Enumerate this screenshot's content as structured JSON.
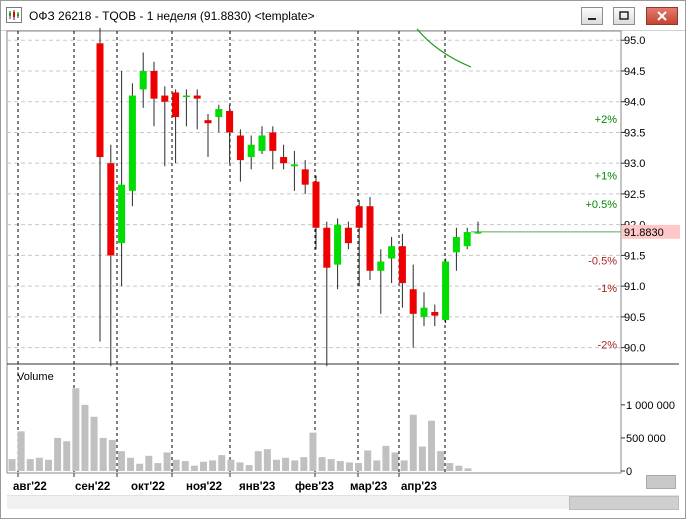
{
  "window": {
    "title": "ОФЗ 26218 - TQOB - 1 неделя (91.8830) <template>",
    "icons": [
      "chart-window-icon",
      "minimize-icon",
      "maximize-icon",
      "close-icon"
    ]
  },
  "colors": {
    "up": "#00dd00",
    "down": "#ee0000",
    "wick": "#2a2a2a",
    "volume_bar": "#c0c0c0",
    "grid": "#c8c8c8",
    "period_separator": "#000000",
    "pct_positive": "#008800",
    "pct_negative": "#aa2222",
    "price_marker_bg": "#ffc8c8",
    "price_line": "#5aaa5a"
  },
  "chart_data": {
    "type": "candlestick",
    "price_axis": {
      "ticks": [
        "95.0",
        "94.5",
        "94.0",
        "93.5",
        "93.0",
        "92.5",
        "92.0",
        "91.5",
        "91.0",
        "90.5",
        "90.0"
      ],
      "ylim": [
        89.75,
        95.15
      ]
    },
    "time_axis": {
      "labels": [
        "авг'22",
        "сен'22",
        "окт'22",
        "ноя'22",
        "янв'23",
        "фев'23",
        "мар'23",
        "апр'23"
      ]
    },
    "last_price": "91.8830",
    "pct_levels": [
      {
        "label": "+2%",
        "value": 93.72
      },
      {
        "label": "+1%",
        "value": 92.8
      },
      {
        "label": "+0.5%",
        "value": 92.34
      },
      {
        "label": "-0.5%",
        "value": 91.42
      },
      {
        "label": "-1%",
        "value": 90.97
      },
      {
        "label": "-2%",
        "value": 90.05
      }
    ],
    "candles": [
      {
        "o": 94.95,
        "h": 95.2,
        "l": 90.1,
        "c": 93.1
      },
      {
        "o": 93.0,
        "h": 93.3,
        "l": 89.7,
        "c": 91.5
      },
      {
        "o": 91.7,
        "h": 94.5,
        "l": 91.0,
        "c": 92.65
      },
      {
        "o": 92.55,
        "h": 94.3,
        "l": 92.3,
        "c": 94.1
      },
      {
        "o": 94.2,
        "h": 94.8,
        "l": 93.9,
        "c": 94.5
      },
      {
        "o": 94.5,
        "h": 94.65,
        "l": 93.6,
        "c": 94.05
      },
      {
        "o": 94.1,
        "h": 94.25,
        "l": 92.95,
        "c": 94.0
      },
      {
        "o": 94.15,
        "h": 94.2,
        "l": 93.0,
        "c": 93.75
      },
      {
        "o": 94.1,
        "h": 94.2,
        "l": 93.6,
        "c": 94.1
      },
      {
        "o": 94.1,
        "h": 94.2,
        "l": 93.55,
        "c": 94.05
      },
      {
        "o": 93.7,
        "h": 93.8,
        "l": 93.1,
        "c": 93.65
      },
      {
        "o": 93.75,
        "h": 93.95,
        "l": 93.5,
        "c": 93.88
      },
      {
        "o": 93.85,
        "h": 93.95,
        "l": 93.0,
        "c": 93.5
      },
      {
        "o": 93.45,
        "h": 93.55,
        "l": 92.7,
        "c": 93.05
      },
      {
        "o": 93.1,
        "h": 93.45,
        "l": 92.9,
        "c": 93.3
      },
      {
        "o": 93.2,
        "h": 93.6,
        "l": 93.15,
        "c": 93.45
      },
      {
        "o": 93.5,
        "h": 93.6,
        "l": 92.9,
        "c": 93.2
      },
      {
        "o": 93.1,
        "h": 93.3,
        "l": 92.9,
        "c": 93.0
      },
      {
        "o": 92.95,
        "h": 93.2,
        "l": 92.55,
        "c": 92.98
      },
      {
        "o": 92.9,
        "h": 93.05,
        "l": 92.5,
        "c": 92.65
      },
      {
        "o": 92.7,
        "h": 92.8,
        "l": 91.6,
        "c": 91.95
      },
      {
        "o": 91.95,
        "h": 92.05,
        "l": 89.7,
        "c": 91.3
      },
      {
        "o": 91.35,
        "h": 92.1,
        "l": 90.95,
        "c": 92.0
      },
      {
        "o": 91.95,
        "h": 92.05,
        "l": 91.6,
        "c": 91.7
      },
      {
        "o": 92.3,
        "h": 92.4,
        "l": 91.0,
        "c": 91.95
      },
      {
        "o": 92.3,
        "h": 92.45,
        "l": 91.1,
        "c": 91.25
      },
      {
        "o": 91.25,
        "h": 91.6,
        "l": 90.55,
        "c": 91.4
      },
      {
        "o": 91.45,
        "h": 91.8,
        "l": 91.05,
        "c": 91.65
      },
      {
        "o": 91.65,
        "h": 91.85,
        "l": 90.65,
        "c": 91.05
      },
      {
        "o": 90.95,
        "h": 91.35,
        "l": 90.0,
        "c": 90.55
      },
      {
        "o": 90.5,
        "h": 90.9,
        "l": 90.35,
        "c": 90.65
      },
      {
        "o": 90.58,
        "h": 90.7,
        "l": 90.35,
        "c": 90.52
      },
      {
        "o": 90.45,
        "h": 91.45,
        "l": 90.4,
        "c": 91.4
      },
      {
        "o": 91.55,
        "h": 91.95,
        "l": 91.25,
        "c": 91.8
      },
      {
        "o": 91.65,
        "h": 91.95,
        "l": 91.6,
        "c": 91.88
      },
      {
        "o": 91.88,
        "h": 92.05,
        "l": 91.85,
        "c": 91.88
      }
    ],
    "volume": {
      "title": "Volume",
      "ticks": [
        "1 000 000",
        "500 000",
        "0"
      ],
      "ylim": [
        0,
        1300000
      ],
      "values": [
        180000,
        600000,
        180000,
        200000,
        170000,
        500000,
        450000,
        1250000,
        1000000,
        820000,
        500000,
        470000,
        300000,
        200000,
        110000,
        230000,
        120000,
        280000,
        170000,
        150000,
        80000,
        140000,
        160000,
        240000,
        170000,
        130000,
        90000,
        300000,
        330000,
        170000,
        200000,
        160000,
        210000,
        580000,
        210000,
        180000,
        150000,
        130000,
        120000,
        310000,
        160000,
        380000,
        280000,
        160000,
        850000,
        370000,
        760000,
        300000,
        120000,
        80000,
        40000
      ]
    }
  }
}
